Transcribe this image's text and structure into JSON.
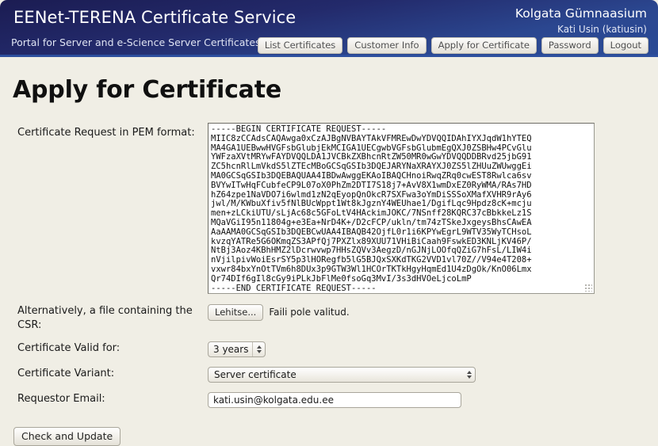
{
  "header": {
    "brand_title": "EENet-TERENA Certificate Service",
    "brand_subtitle": "Portal for Server and e-Science Server Certificates",
    "account_org": "Kolgata Gümnaasium",
    "account_user": "Kati Usin (katiusin)",
    "nav": [
      {
        "label": "List Certificates",
        "name": "nav-list-certificates"
      },
      {
        "label": "Customer Info",
        "name": "nav-customer-info"
      },
      {
        "label": "Apply for Certificate",
        "name": "nav-apply-for-certificate"
      },
      {
        "label": "Password",
        "name": "nav-password"
      },
      {
        "label": "Logout",
        "name": "nav-logout"
      }
    ],
    "colors": {
      "gradient_start": "#1b1c52",
      "gradient_end": "#2a4a96",
      "bottom_rule": "#2d4f9e",
      "page_background": "#f0eee5"
    }
  },
  "page": {
    "title": "Apply for Certificate"
  },
  "form": {
    "pem_label": "Certificate Request in PEM format:",
    "pem_value": "-----BEGIN CERTIFICATE REQUEST-----\nMIIC8zCCAdsCAQAwga0xCzAJBgNVBAYTAkVFMREwDwYDVQQIDAhIYXJqdW1hYTEQ\nMA4GA1UEBwwHVGFsbGlubjEkMCIGA1UECgwbVGFsbGlubmEgQXJ0ZSBHw4PCvGlu\nYWFzaXVtMRYwFAYDVQQLDA1JVCBkZXBhcnRtZW50MR0wGwYDVQQDDBRvd25jbG91\nZC5hcnRlLmVkdS5lZTEcMBoGCSqGSIb3DQEJARYNaXRAYXJ0ZS5lZHUuZWUwggEi\nMA0GCSqGSIb3DQEBAQUAA4IBDwAwggEKAoIBAQCHnoiRwqZRq0cwEST8Rwlca6sv\nBVYwITwHqFCubfeCP9L07oX0PhZm2DTI7S18j7+AvV8X1wmDxEZ0RyWMA/RAs7HD\nhZ64zpe1NaVDO7i6wlmd1zN2qEyopQnOkcR7SXFwa3oYmDiSSSoXMafXVHR9rAy6\njwl/M/KWbuXfiv5fNlBUcWppt1Wt8kJgznY4WEUhae1/DgifLqc9Hpdz8cK+mcju\nmen+zLCkiUTU/sLjAc68c5GFoLtV4HAckimJOKC/7NSnff28KQRC37cBbkkeLz1S\nMQaVGiI95n11804g+e3Ea+NrD4K+/D2cFCP/ukln/tm74zTSkeJxgeysBhsCAwEA\nAaAAMA0GCSqGSIb3DQEBCwUAA4IBAQB42OjfL0r1i6KPYwEgrL9WTV35WyTCHsoL\nkvzqYATRe5G6OKmqZS3APfQj7PXZlx89XUU71VHiBiCaah9FswkED3KNLjKV46P/\nNtBj3Aoz4KBhHMZ2lDcrwvwp7HHsZQVv3AegzD/nGJNjLOOfqQZiG7hFsL/LIW4i\nnVjilpivWoiEsrSY5p3lHORegfb5lG5BJQxSXKdTKG2VVD1vl70Z//V94e4T208+\nvxwr84bxYnOtTVm6h8DUx3p9GTW3Wl1HCOrTKTkHgyHqmEd1U4zDgOk/KnO06Lmx\nQr74DIf6gIl8cGy9iPLkJbFlMe0fsoGq3MvI/3s3dHVOeLjcoLmP\n-----END CERTIFICATE REQUEST-----",
    "file_label": "Alternatively, a file containing the CSR:",
    "file_button": "Lehitse...",
    "file_status": "Faili pole valitud.",
    "valid_label": "Certificate Valid for:",
    "valid_value": "3 years",
    "variant_label": "Certificate Variant:",
    "variant_value": "Server certificate",
    "email_label": "Requestor Email:",
    "email_value": "kati.usin@kolgata.edu.ee",
    "submit_label": "Check and Update"
  }
}
